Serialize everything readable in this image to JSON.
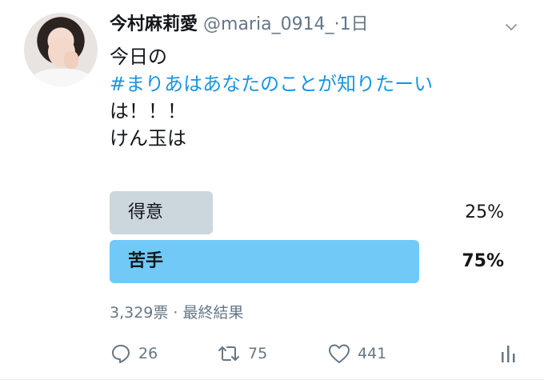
{
  "author": {
    "name": "今村麻莉愛",
    "handle": "@maria_0914_",
    "separator": "·",
    "time": "1日"
  },
  "tweet": {
    "lines": [
      "今日の",
      "#まりあはあなたのことが知りたーい",
      "は！！！",
      "けん玉は"
    ]
  },
  "poll": {
    "options": [
      {
        "label": "得意",
        "percent": "25%",
        "fill": 0.25,
        "color": "#ccd6dd"
      },
      {
        "label": "苦手",
        "percent": "75%",
        "fill": 0.75,
        "color": "#71c9f8"
      }
    ],
    "meta": "3,329票 · 最終結果"
  },
  "actions": {
    "reply_count": "26",
    "retweet_count": "75",
    "like_count": "441"
  },
  "icons": {
    "chevron": "chevron-down-icon",
    "reply": "reply-icon",
    "retweet": "retweet-icon",
    "like": "heart-icon",
    "analytics": "analytics-icon"
  },
  "colors": {
    "hashtag": "#1b95e0",
    "muted": "#657786",
    "winner_bar": "#71c9f8",
    "loser_bar": "#ccd6dd"
  }
}
